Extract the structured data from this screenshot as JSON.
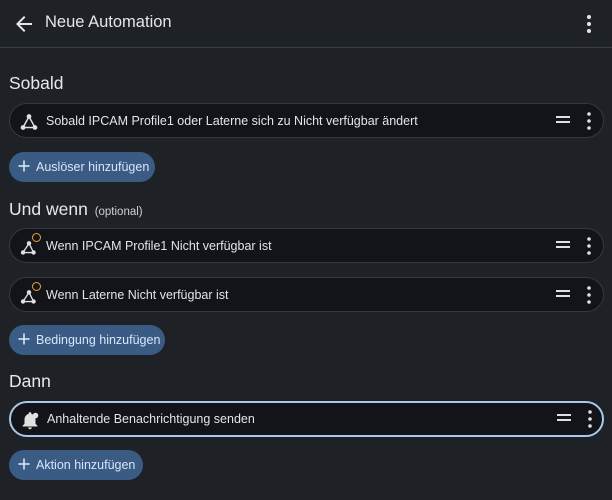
{
  "header": {
    "title": "Neue Automation"
  },
  "sections": {
    "triggers": {
      "heading": "Sobald",
      "items": [
        {
          "label": "Sobald IPCAM Profile1 oder Laterne sich zu Nicht verfügbar ändert",
          "icon": "trigger-icon"
        }
      ],
      "add_label": "Auslöser hinzufügen"
    },
    "conditions": {
      "heading": "Und wenn",
      "heading_suffix": "(optional)",
      "items": [
        {
          "label": "Wenn IPCAM Profile1 Nicht verfügbar ist",
          "icon": "state-condition-icon"
        },
        {
          "label": "Wenn Laterne Nicht verfügbar ist",
          "icon": "state-condition-icon"
        }
      ],
      "add_label": "Bedingung hinzufügen"
    },
    "actions": {
      "heading": "Dann",
      "items": [
        {
          "label": "Anhaltende Benachrichtigung senden",
          "icon": "persistent-notification-icon"
        }
      ],
      "add_label": "Aktion hinzufügen"
    }
  },
  "colors": {
    "background": "#1e2126",
    "card": "#121419",
    "button": "#3a5b84",
    "badge": "#f1a033",
    "selected_border": "#a9c8ea"
  }
}
